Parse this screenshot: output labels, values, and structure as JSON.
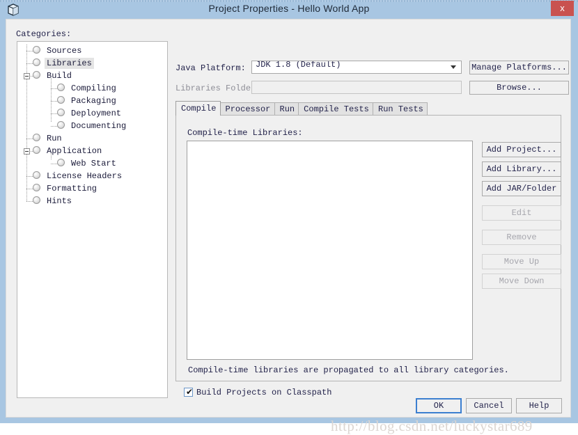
{
  "window": {
    "title": "Project Properties - Hello World App",
    "icon": "cube-icon",
    "close_label": "x",
    "accent_blue": "#a8c6e2",
    "close_red": "#c9524f"
  },
  "categories": {
    "label": "Categories:",
    "selected": "Libraries",
    "items": [
      {
        "label": "Sources",
        "depth": 0,
        "expander": "none"
      },
      {
        "label": "Libraries",
        "depth": 0,
        "expander": "none"
      },
      {
        "label": "Build",
        "depth": 0,
        "expander": "minus"
      },
      {
        "label": "Compiling",
        "depth": 1,
        "expander": "none"
      },
      {
        "label": "Packaging",
        "depth": 1,
        "expander": "none"
      },
      {
        "label": "Deployment",
        "depth": 1,
        "expander": "none"
      },
      {
        "label": "Documenting",
        "depth": 1,
        "expander": "none"
      },
      {
        "label": "Run",
        "depth": 0,
        "expander": "none"
      },
      {
        "label": "Application",
        "depth": 0,
        "expander": "minus"
      },
      {
        "label": "Web Start",
        "depth": 1,
        "expander": "none"
      },
      {
        "label": "License Headers",
        "depth": 0,
        "expander": "none"
      },
      {
        "label": "Formatting",
        "depth": 0,
        "expander": "none"
      },
      {
        "label": "Hints",
        "depth": 0,
        "expander": "none"
      }
    ]
  },
  "platform": {
    "java_platform_label": "Java Platform:",
    "java_platform_value": "JDK 1.8 (Default)",
    "manage_platforms_label": "Manage Platforms...",
    "libraries_folder_label": "Libraries Folder:",
    "libraries_folder_value": "",
    "browse_label": "Browse..."
  },
  "tabs": [
    {
      "label": "Compile",
      "active": true
    },
    {
      "label": "Processor",
      "active": false
    },
    {
      "label": "Run",
      "active": false
    },
    {
      "label": "Compile Tests",
      "active": false
    },
    {
      "label": "Run Tests",
      "active": false
    }
  ],
  "compile_panel": {
    "list_label": "Compile-time Libraries:",
    "list_items": [],
    "note": "Compile-time libraries are propagated to all library categories.",
    "buttons": [
      {
        "label": "Add Project...",
        "enabled": true
      },
      {
        "label": "Add Library...",
        "enabled": true
      },
      {
        "label": "Add JAR/Folder",
        "enabled": true
      },
      {
        "label": "Edit",
        "enabled": false
      },
      {
        "label": "Remove",
        "enabled": false
      },
      {
        "label": "Move Up",
        "enabled": false
      },
      {
        "label": "Move Down",
        "enabled": false
      }
    ]
  },
  "classpath_checkbox": {
    "label": "Build Projects on Classpath",
    "checked": true,
    "tick": "✔"
  },
  "footer": {
    "ok_label": "OK",
    "cancel_label": "Cancel",
    "help_label": "Help",
    "watermark": "http://blog.csdn.net/luckystar689"
  }
}
